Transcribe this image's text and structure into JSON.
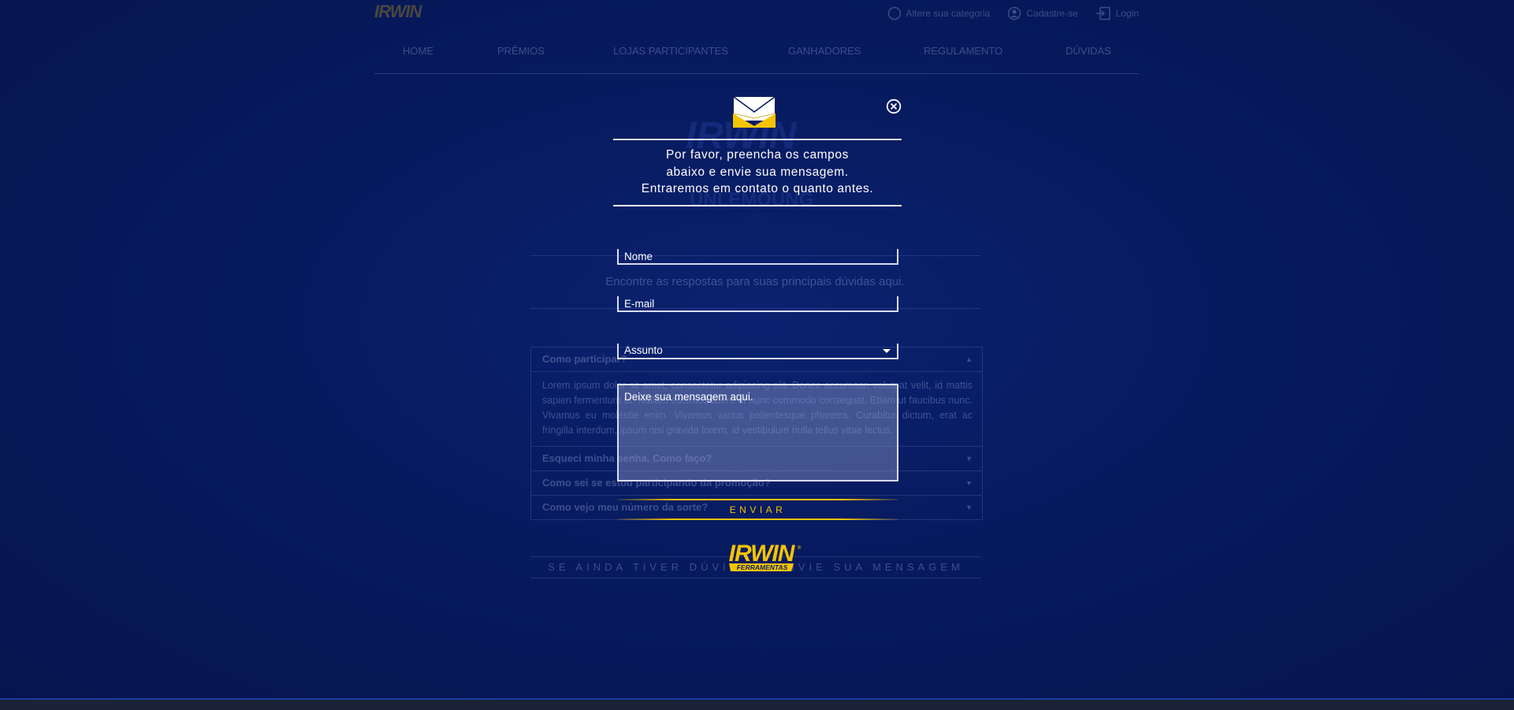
{
  "header": {
    "logo_text": "IRWIN",
    "links": [
      {
        "label": "Altere sua categoria",
        "icon": "circle-icon"
      },
      {
        "label": "Cadastre-se",
        "icon": "user-icon"
      },
      {
        "label": "Login",
        "icon": "login-icon"
      }
    ]
  },
  "nav": {
    "items": [
      "HOME",
      "PRÊMIOS",
      "LOJAS PARTICIPANTES",
      "GANHADORES",
      "REGULAMENTO",
      "DÚVIDAS"
    ]
  },
  "background": {
    "hero_title": "IRWIN",
    "hero_sub": "UNLEMOUNG",
    "find_text": "Encontre as respostas para suas principais dúvidas aqui.",
    "faq": [
      {
        "q": "Como participar?",
        "a": "Lorem ipsum dolor sit amet, consectetur adipiscing elit. Donec accumsan volutpat velit, id mattis sapien fermentum ut. Nullam euismod libero et nunc commodo consequat. Etiam ut faucibus nunc. Vivamus eu molestie enim. Vivamus varius pellentesque pharetra. Curabitur dictum, erat ac fringilla interdum, ipsum nisi gravida lorem, id vestibulum nulla tellus vitae lectus."
      },
      {
        "q": "Esqueci minha senha. Como faço?"
      },
      {
        "q": "Como sei se estou participando da promoção?"
      },
      {
        "q": "Como vejo meu número da sorte?"
      }
    ],
    "send_more": "SE AINDA TIVER DÚVIDAS, ENVIE SUA MENSAGEM"
  },
  "modal": {
    "message_lines": [
      "Por favor, preencha os campos",
      "abaixo e envie sua mensagem.",
      "Entraremos em contato o quanto antes."
    ],
    "name_placeholder": "Nome",
    "email_placeholder": "E-mail",
    "subject_selected": "Assunto",
    "message_placeholder": "Deixe sua mensagem aqui.",
    "send_label": "ENVIAR",
    "brand_text": "IRWIN",
    "brand_sub": "FERRAMENTAS",
    "accent": "#f5c400"
  }
}
